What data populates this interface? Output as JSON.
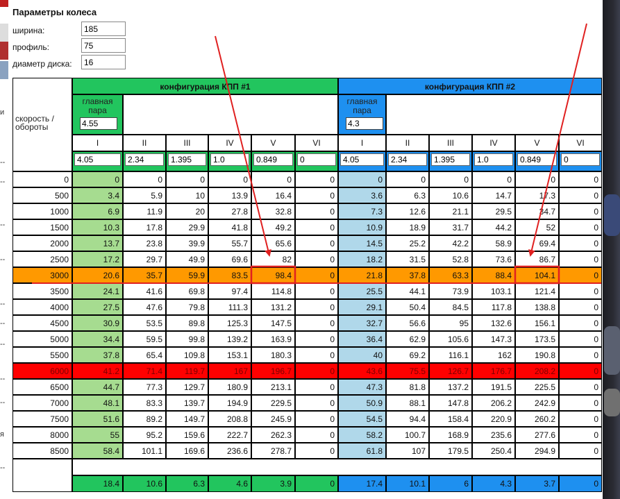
{
  "params": {
    "title": "Параметры колеса",
    "fields": [
      {
        "label": "ширина:",
        "value": "185"
      },
      {
        "label": "профиль:",
        "value": "75"
      },
      {
        "label": "диаметр диска:",
        "value": "16"
      }
    ]
  },
  "table": {
    "corner_label": "скорость / обороты",
    "config1": {
      "title": "конфигурация КПП #1",
      "pair_label": "главная пара",
      "pair_value": "4.55",
      "ratios": [
        "4.05",
        "2.34",
        "1.395",
        "1.0",
        "0.849",
        "0"
      ]
    },
    "config2": {
      "title": "конфигурация КПП #2",
      "pair_label": "главная пара",
      "pair_value": "4.3",
      "ratios": [
        "4.05",
        "2.34",
        "1.395",
        "1.0",
        "0.849",
        "0"
      ]
    },
    "gears": [
      "I",
      "II",
      "III",
      "IV",
      "V",
      "VI"
    ],
    "rows": [
      {
        "rpm": "0",
        "c1": [
          "0",
          "0",
          "0",
          "0",
          "0",
          "0"
        ],
        "c2": [
          "0",
          "0",
          "0",
          "0",
          "0",
          "0"
        ]
      },
      {
        "rpm": "500",
        "c1": [
          "3.4",
          "5.9",
          "10",
          "13.9",
          "16.4",
          "0"
        ],
        "c2": [
          "3.6",
          "6.3",
          "10.6",
          "14.7",
          "17.3",
          "0"
        ]
      },
      {
        "rpm": "1000",
        "c1": [
          "6.9",
          "11.9",
          "20",
          "27.8",
          "32.8",
          "0"
        ],
        "c2": [
          "7.3",
          "12.6",
          "21.1",
          "29.5",
          "34.7",
          "0"
        ]
      },
      {
        "rpm": "1500",
        "c1": [
          "10.3",
          "17.8",
          "29.9",
          "41.8",
          "49.2",
          "0"
        ],
        "c2": [
          "10.9",
          "18.9",
          "31.7",
          "44.2",
          "52",
          "0"
        ]
      },
      {
        "rpm": "2000",
        "c1": [
          "13.7",
          "23.8",
          "39.9",
          "55.7",
          "65.6",
          "0"
        ],
        "c2": [
          "14.5",
          "25.2",
          "42.2",
          "58.9",
          "69.4",
          "0"
        ]
      },
      {
        "rpm": "2500",
        "c1": [
          "17.2",
          "29.7",
          "49.9",
          "69.6",
          "82",
          "0"
        ],
        "c2": [
          "18.2",
          "31.5",
          "52.8",
          "73.6",
          "86.7",
          "0"
        ]
      },
      {
        "rpm": "3000",
        "c1": [
          "20.6",
          "35.7",
          "59.9",
          "83.5",
          "98.4",
          "0"
        ],
        "c2": [
          "21.8",
          "37.8",
          "63.3",
          "88.4",
          "104.1",
          "0"
        ],
        "hl": "orange"
      },
      {
        "rpm": "3500",
        "c1": [
          "24.1",
          "41.6",
          "69.8",
          "97.4",
          "114.8",
          "0"
        ],
        "c2": [
          "25.5",
          "44.1",
          "73.9",
          "103.1",
          "121.4",
          "0"
        ]
      },
      {
        "rpm": "4000",
        "c1": [
          "27.5",
          "47.6",
          "79.8",
          "111.3",
          "131.2",
          "0"
        ],
        "c2": [
          "29.1",
          "50.4",
          "84.5",
          "117.8",
          "138.8",
          "0"
        ]
      },
      {
        "rpm": "4500",
        "c1": [
          "30.9",
          "53.5",
          "89.8",
          "125.3",
          "147.5",
          "0"
        ],
        "c2": [
          "32.7",
          "56.6",
          "95",
          "132.6",
          "156.1",
          "0"
        ]
      },
      {
        "rpm": "5000",
        "c1": [
          "34.4",
          "59.5",
          "99.8",
          "139.2",
          "163.9",
          "0"
        ],
        "c2": [
          "36.4",
          "62.9",
          "105.6",
          "147.3",
          "173.5",
          "0"
        ]
      },
      {
        "rpm": "5500",
        "c1": [
          "37.8",
          "65.4",
          "109.8",
          "153.1",
          "180.3",
          "0"
        ],
        "c2": [
          "40",
          "69.2",
          "116.1",
          "162",
          "190.8",
          "0"
        ]
      },
      {
        "rpm": "6000",
        "c1": [
          "41.2",
          "71.4",
          "119.7",
          "167",
          "196.7",
          "0"
        ],
        "c2": [
          "43.6",
          "75.5",
          "126.7",
          "176.7",
          "208.2",
          "0"
        ],
        "hl": "red"
      },
      {
        "rpm": "6500",
        "c1": [
          "44.7",
          "77.3",
          "129.7",
          "180.9",
          "213.1",
          "0"
        ],
        "c2": [
          "47.3",
          "81.8",
          "137.2",
          "191.5",
          "225.5",
          "0"
        ]
      },
      {
        "rpm": "7000",
        "c1": [
          "48.1",
          "83.3",
          "139.7",
          "194.9",
          "229.5",
          "0"
        ],
        "c2": [
          "50.9",
          "88.1",
          "147.8",
          "206.2",
          "242.9",
          "0"
        ]
      },
      {
        "rpm": "7500",
        "c1": [
          "51.6",
          "89.2",
          "149.7",
          "208.8",
          "245.9",
          "0"
        ],
        "c2": [
          "54.5",
          "94.4",
          "158.4",
          "220.9",
          "260.2",
          "0"
        ]
      },
      {
        "rpm": "8000",
        "c1": [
          "55",
          "95.2",
          "159.6",
          "222.7",
          "262.3",
          "0"
        ],
        "c2": [
          "58.2",
          "100.7",
          "168.9",
          "235.6",
          "277.6",
          "0"
        ]
      },
      {
        "rpm": "8500",
        "c1": [
          "58.4",
          "101.1",
          "169.6",
          "236.6",
          "278.7",
          "0"
        ],
        "c2": [
          "61.8",
          "107",
          "179.5",
          "250.4",
          "294.9",
          "0"
        ]
      }
    ],
    "footer": {
      "c1": [
        "18.4",
        "10.6",
        "6.3",
        "4.6",
        "3.9",
        "0"
      ],
      "c2": [
        "17.4",
        "10.1",
        "6",
        "4.3",
        "3.7",
        "0"
      ]
    }
  },
  "colors": {
    "config1_header": "#22c55e",
    "config2_header": "#1e90f0",
    "col1_fill": "#a6dc90",
    "col2_fill": "#b0d8ea",
    "highlight_orange": "#ff9900",
    "highlight_red": "#ff0000",
    "annotation": "#e02020"
  },
  "left_fragment": [
    "и",
    "--",
    "--",
    "--",
    "--",
    "--",
    "--",
    "--",
    "--",
    "--",
    "я",
    "--"
  ]
}
